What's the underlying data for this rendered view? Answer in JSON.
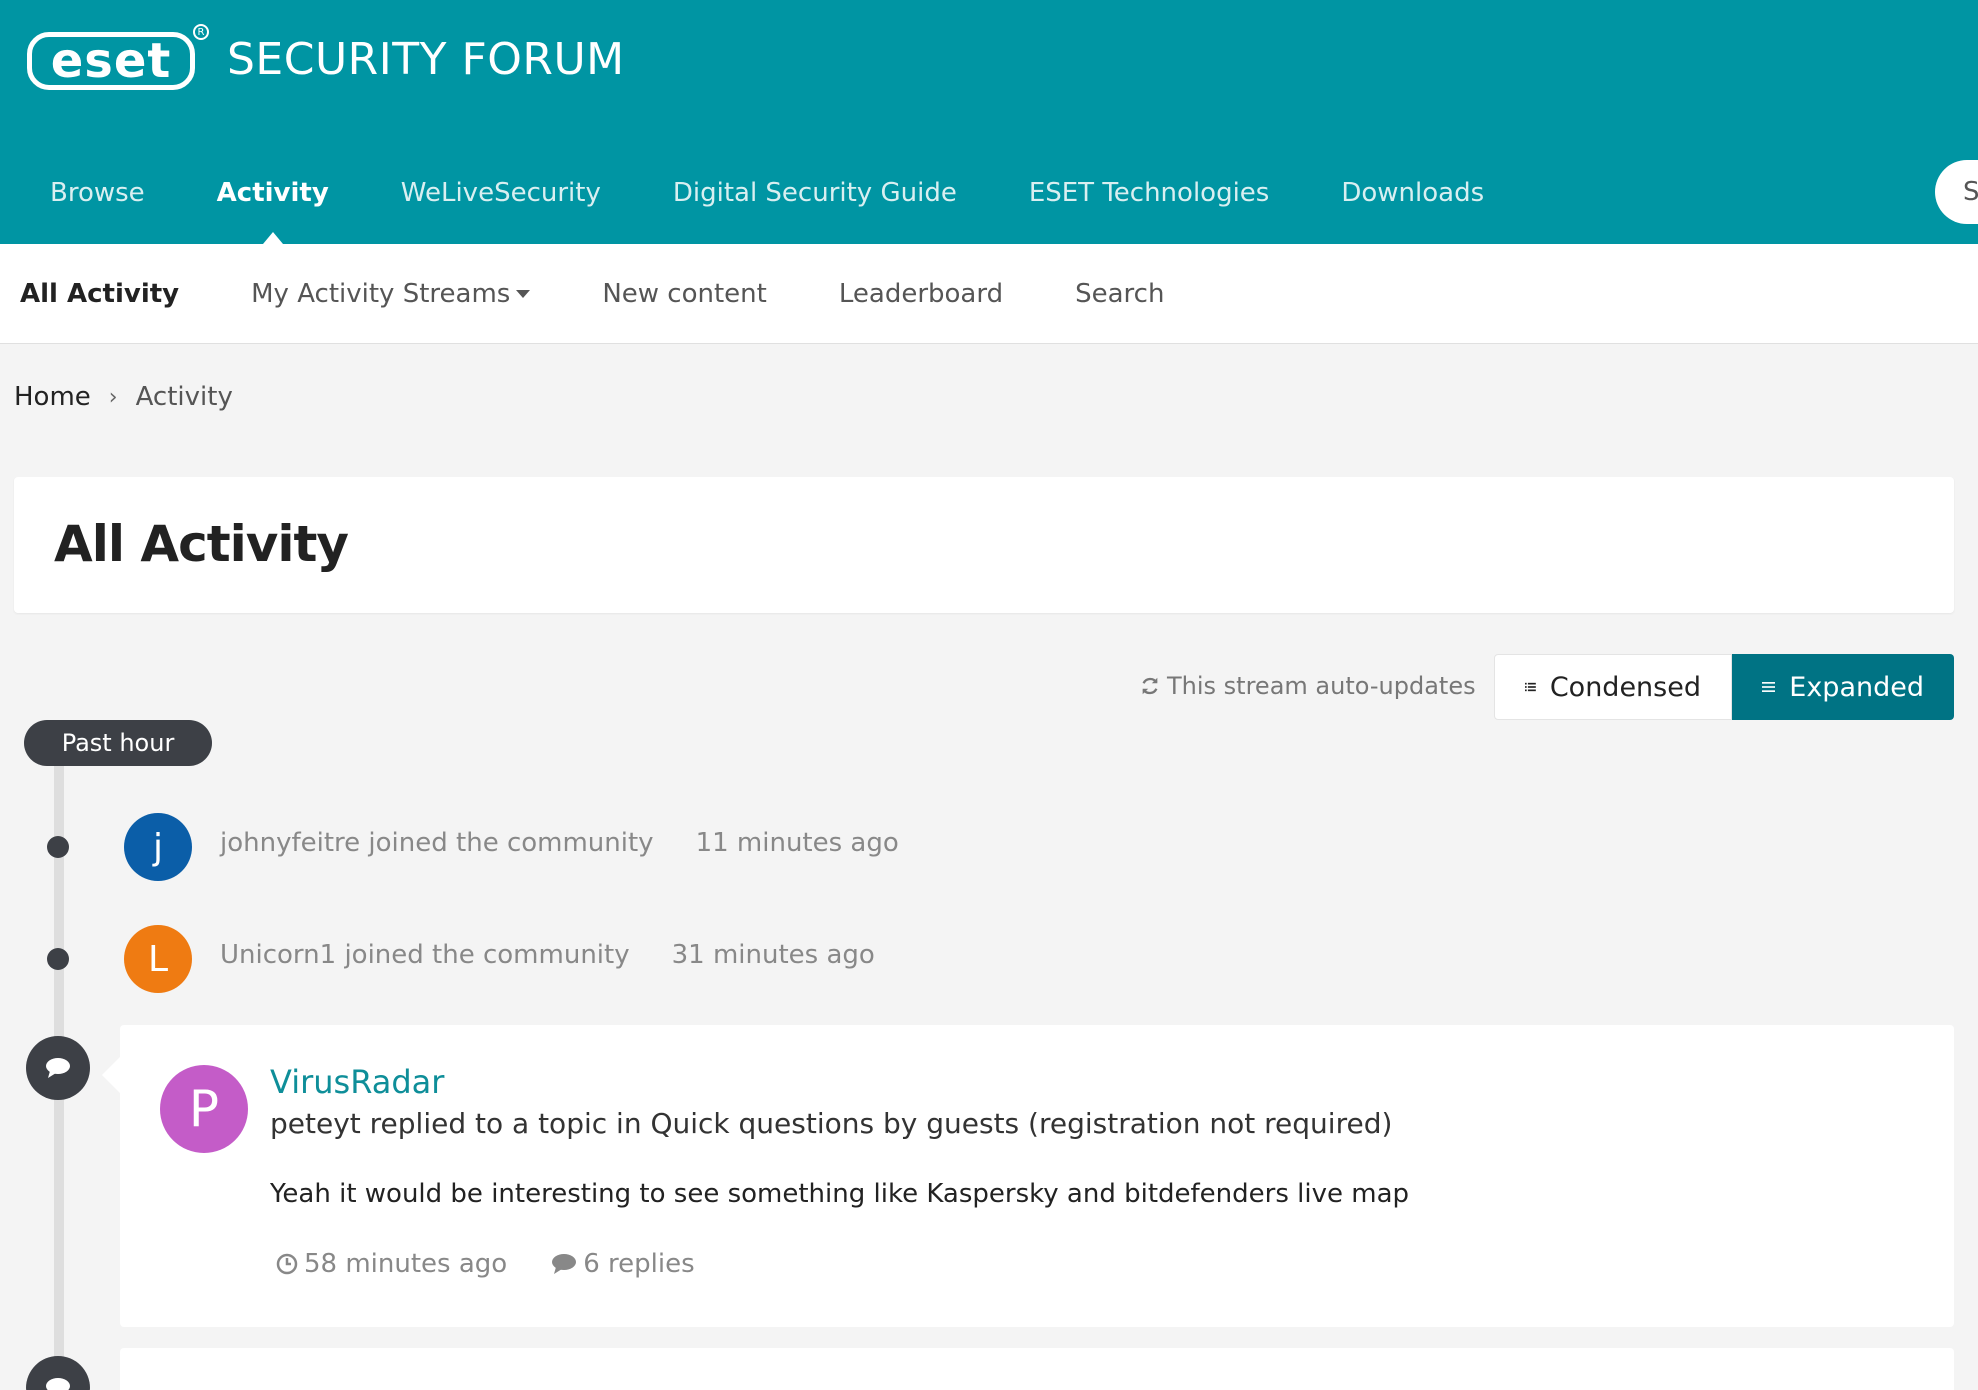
{
  "brand": {
    "logo_text": "eset",
    "forum_title": "SECURITY FORUM",
    "primary_color": "#0095a3",
    "dark_accent": "#007384"
  },
  "main_nav": {
    "items": [
      {
        "label": "Browse",
        "active": false
      },
      {
        "label": "Activity",
        "active": true
      },
      {
        "label": "WeLiveSecurity",
        "active": false
      },
      {
        "label": "Digital Security Guide",
        "active": false
      },
      {
        "label": "ESET Technologies",
        "active": false
      },
      {
        "label": "Downloads",
        "active": false
      }
    ],
    "search_label": "S"
  },
  "sub_nav": {
    "items": [
      {
        "label": "All Activity",
        "active": true
      },
      {
        "label": "My Activity Streams",
        "has_dropdown": true
      },
      {
        "label": "New content"
      },
      {
        "label": "Leaderboard"
      },
      {
        "label": "Search"
      }
    ]
  },
  "breadcrumb": {
    "home": "Home",
    "separator": ">",
    "current": "Activity"
  },
  "page": {
    "title": "All Activity",
    "auto_updates": "This stream auto-updates",
    "view_condensed": "Condensed",
    "view_expanded": "Expanded",
    "active_view": "Expanded"
  },
  "stream": {
    "period_label": "Past hour",
    "joins": [
      {
        "avatar_letter": "j",
        "avatar_color": "#0b5ea8",
        "text": "johnyfeitre joined the community",
        "time": "11 minutes ago"
      },
      {
        "avatar_letter": "L",
        "avatar_color": "#ef7b12",
        "text": "Unicorn1 joined the community",
        "time": "31 minutes ago"
      }
    ],
    "posts": [
      {
        "avatar_letter": "P",
        "avatar_color": "#c45cc8",
        "author": "VirusRadar",
        "summary": "peteyt replied to a topic in Quick questions by guests (registration not required)",
        "excerpt": "Yeah it would be interesting to see something like Kaspersky and bitdefenders live map",
        "time": "58 minutes ago",
        "replies": "6 replies"
      }
    ]
  }
}
